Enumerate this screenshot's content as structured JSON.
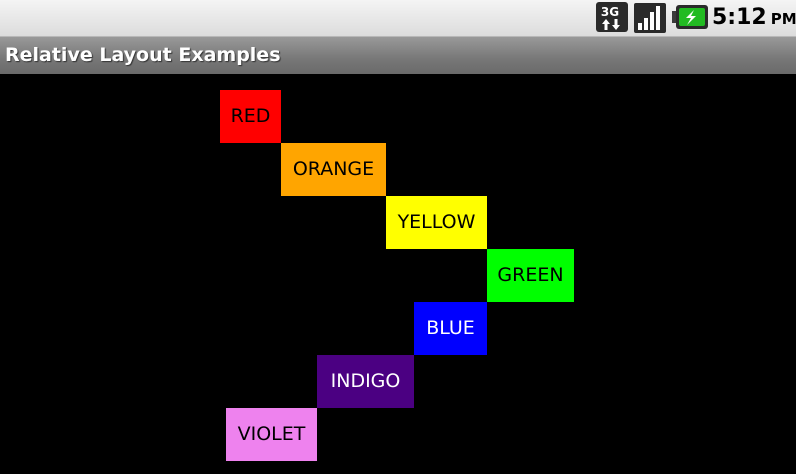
{
  "status_bar": {
    "network_type": "3G",
    "time": "5:12",
    "ampm": "PM"
  },
  "title_bar": {
    "title": "Relative Layout Examples"
  },
  "boxes": [
    {
      "label": "RED",
      "bg": "#ff0000",
      "fg": "#000000"
    },
    {
      "label": "ORANGE",
      "bg": "#ffa500",
      "fg": "#000000"
    },
    {
      "label": "YELLOW",
      "bg": "#ffff00",
      "fg": "#000000"
    },
    {
      "label": "GREEN",
      "bg": "#00ff00",
      "fg": "#000000"
    },
    {
      "label": "BLUE",
      "bg": "#0000ff",
      "fg": "#ffffff"
    },
    {
      "label": "INDIGO",
      "bg": "#4b0082",
      "fg": "#ffffff"
    },
    {
      "label": "VIOLET",
      "bg": "#ee82ee",
      "fg": "#000000"
    }
  ]
}
